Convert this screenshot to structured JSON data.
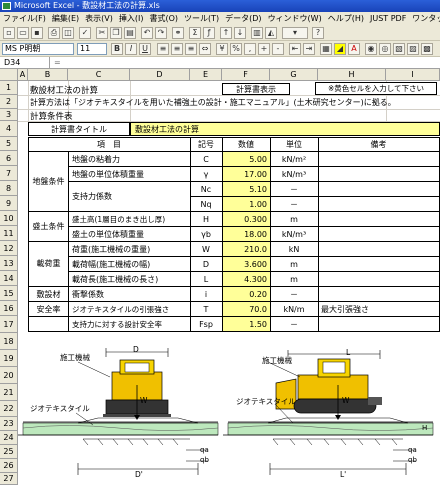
{
  "window": {
    "title": "Microsoft Excel - 敷設材工法の計算.xls"
  },
  "menu": [
    "ファイル(F)",
    "編集(E)",
    "表示(V)",
    "挿入(I)",
    "書式(O)",
    "ツール(T)",
    "データ(D)",
    "ウィンドウ(W)",
    "ヘルプ(H)",
    "JUST PDF",
    "ワンタッチOCR"
  ],
  "toolbar": {
    "font_name": "MS P明朝",
    "font_size": "11",
    "bold": "B",
    "italic": "I",
    "underline": "U"
  },
  "formula_bar": {
    "cell_ref": "D34"
  },
  "columns": [
    "A",
    "B",
    "C",
    "D",
    "E",
    "F",
    "G",
    "H",
    "I"
  ],
  "rows": [
    "1",
    "2",
    "3",
    "4",
    "5",
    "6",
    "7",
    "8",
    "9",
    "10",
    "11",
    "12",
    "13",
    "14",
    "15",
    "16",
    "17",
    "18",
    "19",
    "20",
    "21",
    "22",
    "23",
    "24",
    "25",
    "26",
    "27",
    "28"
  ],
  "sheet": {
    "title": "敷設材工法の計算",
    "calc_button": "計算書表示",
    "note": "※黄色セルを入力して下さい",
    "method": "計算方法は「ジオテキスタイルを用いた補強土の設計・施工マニュアル」(土木研究センター)に拠る。",
    "conditions_header": "計算条件表",
    "sheet_title_label": "計算書タイトル",
    "sheet_title_value": "敷設材工法の計算",
    "table_headers": {
      "item": "項　目",
      "symbol": "記号",
      "value": "数値",
      "unit": "単位",
      "remarks": "備考"
    },
    "groups": {
      "ground": "地盤条件",
      "embankment": "盛土条件",
      "load": "載荷重",
      "material": "敷設材",
      "safety": "安全率"
    },
    "rows": [
      {
        "item": "地盤の粘着力",
        "symbol": "C",
        "value": "5.00",
        "unit": "kN/m²",
        "remarks": ""
      },
      {
        "item": "地盤の単位体積重量",
        "symbol": "γ",
        "value": "17.00",
        "unit": "kN/m³",
        "remarks": ""
      },
      {
        "item": "支持力係数",
        "symbol": "Nc",
        "value": "5.10",
        "unit": "－",
        "remarks": ""
      },
      {
        "item": "",
        "symbol": "Nq",
        "value": "1.00",
        "unit": "－",
        "remarks": ""
      },
      {
        "item": "盛土高(1層目のまき出し厚)",
        "symbol": "H",
        "value": "0.300",
        "unit": "m",
        "remarks": ""
      },
      {
        "item": "盛土の単位体積重量",
        "symbol": "γb",
        "value": "18.00",
        "unit": "kN/m³",
        "remarks": ""
      },
      {
        "item": "荷重(施工機械の重量)",
        "symbol": "W",
        "value": "210.0",
        "unit": "kN",
        "remarks": ""
      },
      {
        "item": "載荷幅(施工機械の幅)",
        "symbol": "D",
        "value": "3.600",
        "unit": "m",
        "remarks": ""
      },
      {
        "item": "載荷長(施工機械の長さ)",
        "symbol": "L",
        "value": "4.300",
        "unit": "m",
        "remarks": ""
      },
      {
        "item": "衝撃係数",
        "symbol": "i",
        "value": "0.20",
        "unit": "－",
        "remarks": ""
      },
      {
        "item": "ジオテキスタイルの引張強さ",
        "symbol": "T",
        "value": "70.0",
        "unit": "kN/m",
        "remarks": "最大引張強さ"
      },
      {
        "item": "支持力に対する設計安全率",
        "symbol": "Fsp",
        "value": "1.50",
        "unit": "－",
        "remarks": ""
      }
    ],
    "diagram": {
      "machine": "施工機械",
      "geo": "ジオテキスタイル",
      "D": "D",
      "L": "L",
      "W": "W",
      "Dp": "D'",
      "Lp": "L'",
      "H": "H",
      "qa": "qa",
      "qb": "qb"
    }
  }
}
